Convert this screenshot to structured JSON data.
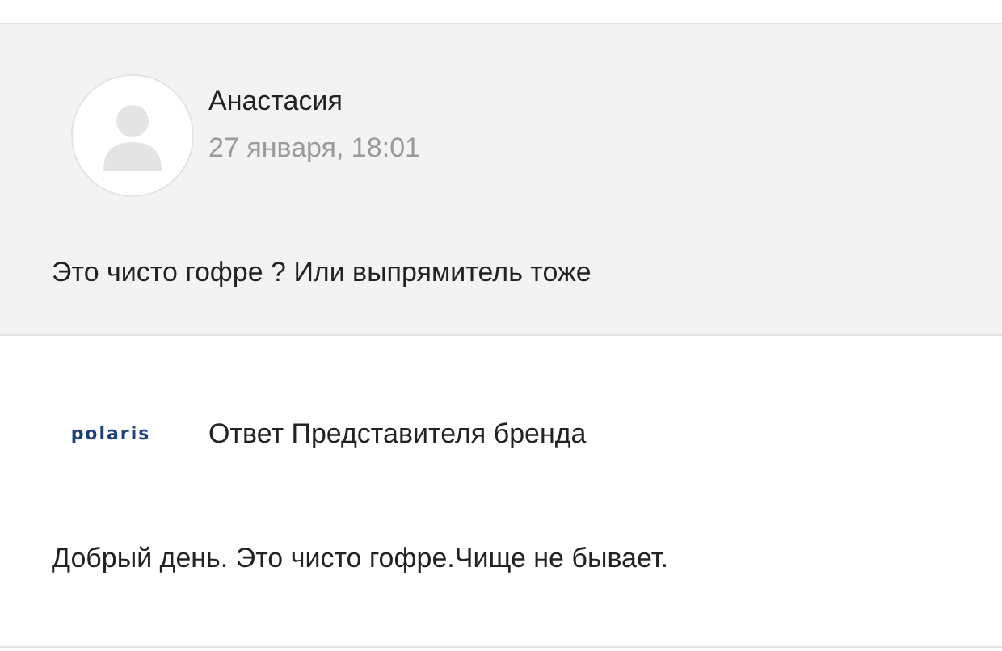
{
  "comment": {
    "author": "Анастасия",
    "date": "27 января, 18:01",
    "text": "Это чисто гофре ? Или выпрямитель тоже"
  },
  "reply": {
    "logo": "polaris",
    "author": "Ответ Представителя бренда",
    "text": "Добрый день. Это чисто гофре.Чище не бывает."
  }
}
